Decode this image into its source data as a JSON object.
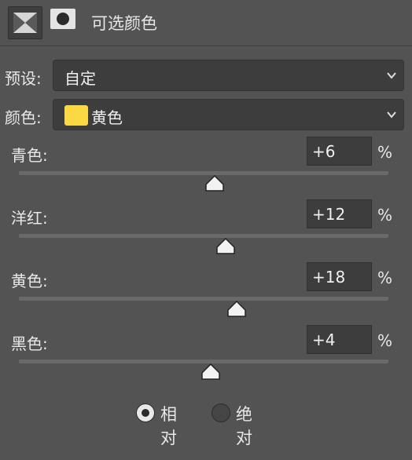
{
  "header": {
    "title": "可选颜色",
    "adjustment_icon": "selective-color-adjustment-icon",
    "mask_icon": "layer-mask-icon"
  },
  "preset": {
    "label": "预设:",
    "value": "自定"
  },
  "colors": {
    "label": "颜色:",
    "value": "黄色",
    "swatch_color": "#fcd843"
  },
  "sliders": [
    {
      "label": "青色:",
      "value": "+6",
      "unit": "%",
      "level": 6
    },
    {
      "label": "洋红:",
      "value": "+12",
      "unit": "%",
      "level": 12
    },
    {
      "label": "黄色:",
      "value": "+18",
      "unit": "%",
      "level": 18
    },
    {
      "label": "黑色:",
      "value": "+4",
      "unit": "%",
      "level": 4
    }
  ],
  "method": {
    "options": [
      {
        "label": "相对",
        "selected": true
      },
      {
        "label": "绝对",
        "selected": false
      }
    ]
  }
}
